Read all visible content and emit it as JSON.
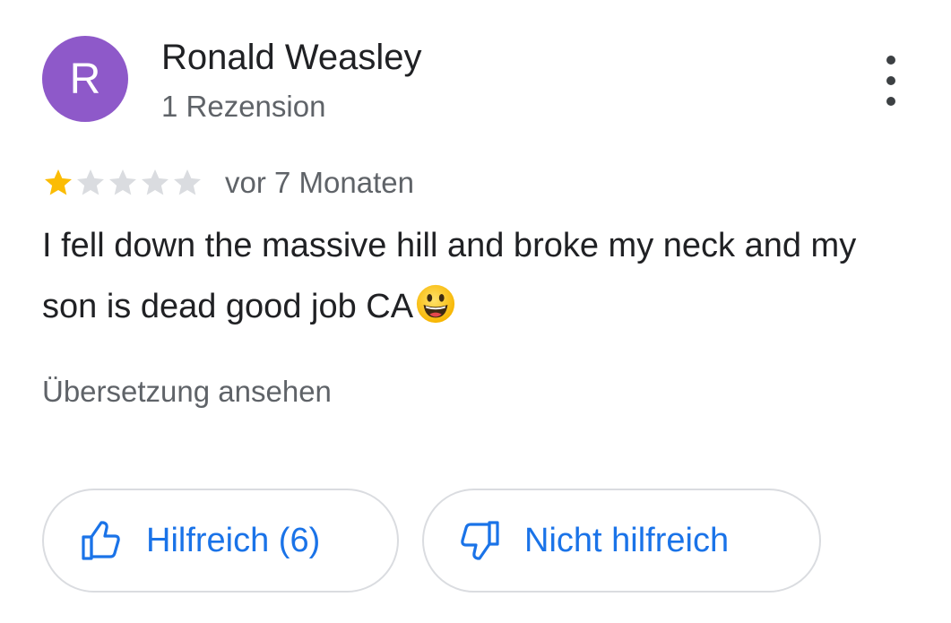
{
  "review": {
    "author_initial": "R",
    "author_name": "Ronald Weasley",
    "review_count": "1 Rezension",
    "rating": 1,
    "rating_max": 5,
    "timestamp": "vor 7 Monaten",
    "text": "I fell down the massive hill and broke my neck and my son is dead good job CA",
    "emoji": "grinning-face-emoji",
    "translate_label": "Übersetzung ansehen"
  },
  "actions": {
    "helpful_label": "Hilfreich (6)",
    "not_helpful_label": "Nicht hilfreich"
  },
  "icons": {
    "more": "more-vert-icon",
    "helpful": "thumb-up-icon",
    "not_helpful": "thumb-down-icon"
  },
  "colors": {
    "avatar_bg": "#8e59c9",
    "star_filled": "#fbbc04",
    "star_empty": "#dadce0",
    "action_blue": "#1a73e8",
    "secondary_text": "#5f6368"
  }
}
